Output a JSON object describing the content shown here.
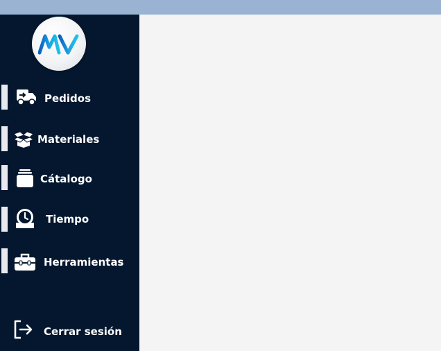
{
  "app": {
    "logo_text": "MV",
    "accent_color": "#1aa3e0",
    "sidebar_color": "#04172f",
    "topbar_color": "#9ab3d3"
  },
  "sidebar": {
    "items": [
      {
        "label": "Pedidos",
        "icon": "truck-icon"
      },
      {
        "label": "Materiales",
        "icon": "open-box-icon"
      },
      {
        "label": "Cátalogo",
        "icon": "stack-icon"
      },
      {
        "label": "Tiempo",
        "icon": "clock-icon"
      },
      {
        "label": "Herramientas",
        "icon": "toolbox-icon"
      }
    ],
    "logout": {
      "label": "Cerrar sesión",
      "icon": "logout-icon"
    }
  }
}
